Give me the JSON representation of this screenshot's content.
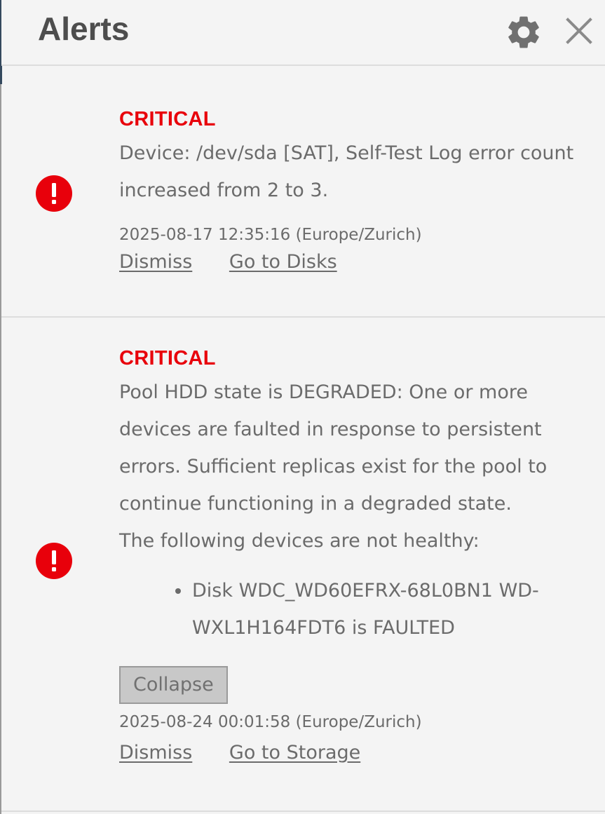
{
  "header": {
    "title": "Alerts",
    "settings_icon": "gear-icon",
    "close_icon": "close-icon"
  },
  "colors": {
    "critical": "#e8000b",
    "text": "#6b6b6b",
    "background": "#f4f4f4"
  },
  "alerts": [
    {
      "level": "CRITICAL",
      "icon": "error-icon",
      "message": "Device: /dev/sda [SAT], Self-Test Log error count increased from 2 to 3.",
      "datetime": "2025-08-17 12:35:16 (Europe/Zurich)",
      "dismiss_label": "Dismiss",
      "goto_label": "Go to Disks"
    },
    {
      "level": "CRITICAL",
      "icon": "error-icon",
      "message": "Pool HDD state is DEGRADED: One or more devices are faulted in response to persistent errors. Sufficient replicas exist for the pool to continue functioning in a degraded state.",
      "message_line2": "The following devices are not healthy:",
      "devices": [
        "Disk WDC_WD60EFRX-68L0BN1 WD-WXL1H164FDT6 is FAULTED"
      ],
      "collapse_label": "Collapse",
      "datetime": "2025-08-24 00:01:58 (Europe/Zurich)",
      "dismiss_label": "Dismiss",
      "goto_label": "Go to Storage"
    }
  ]
}
